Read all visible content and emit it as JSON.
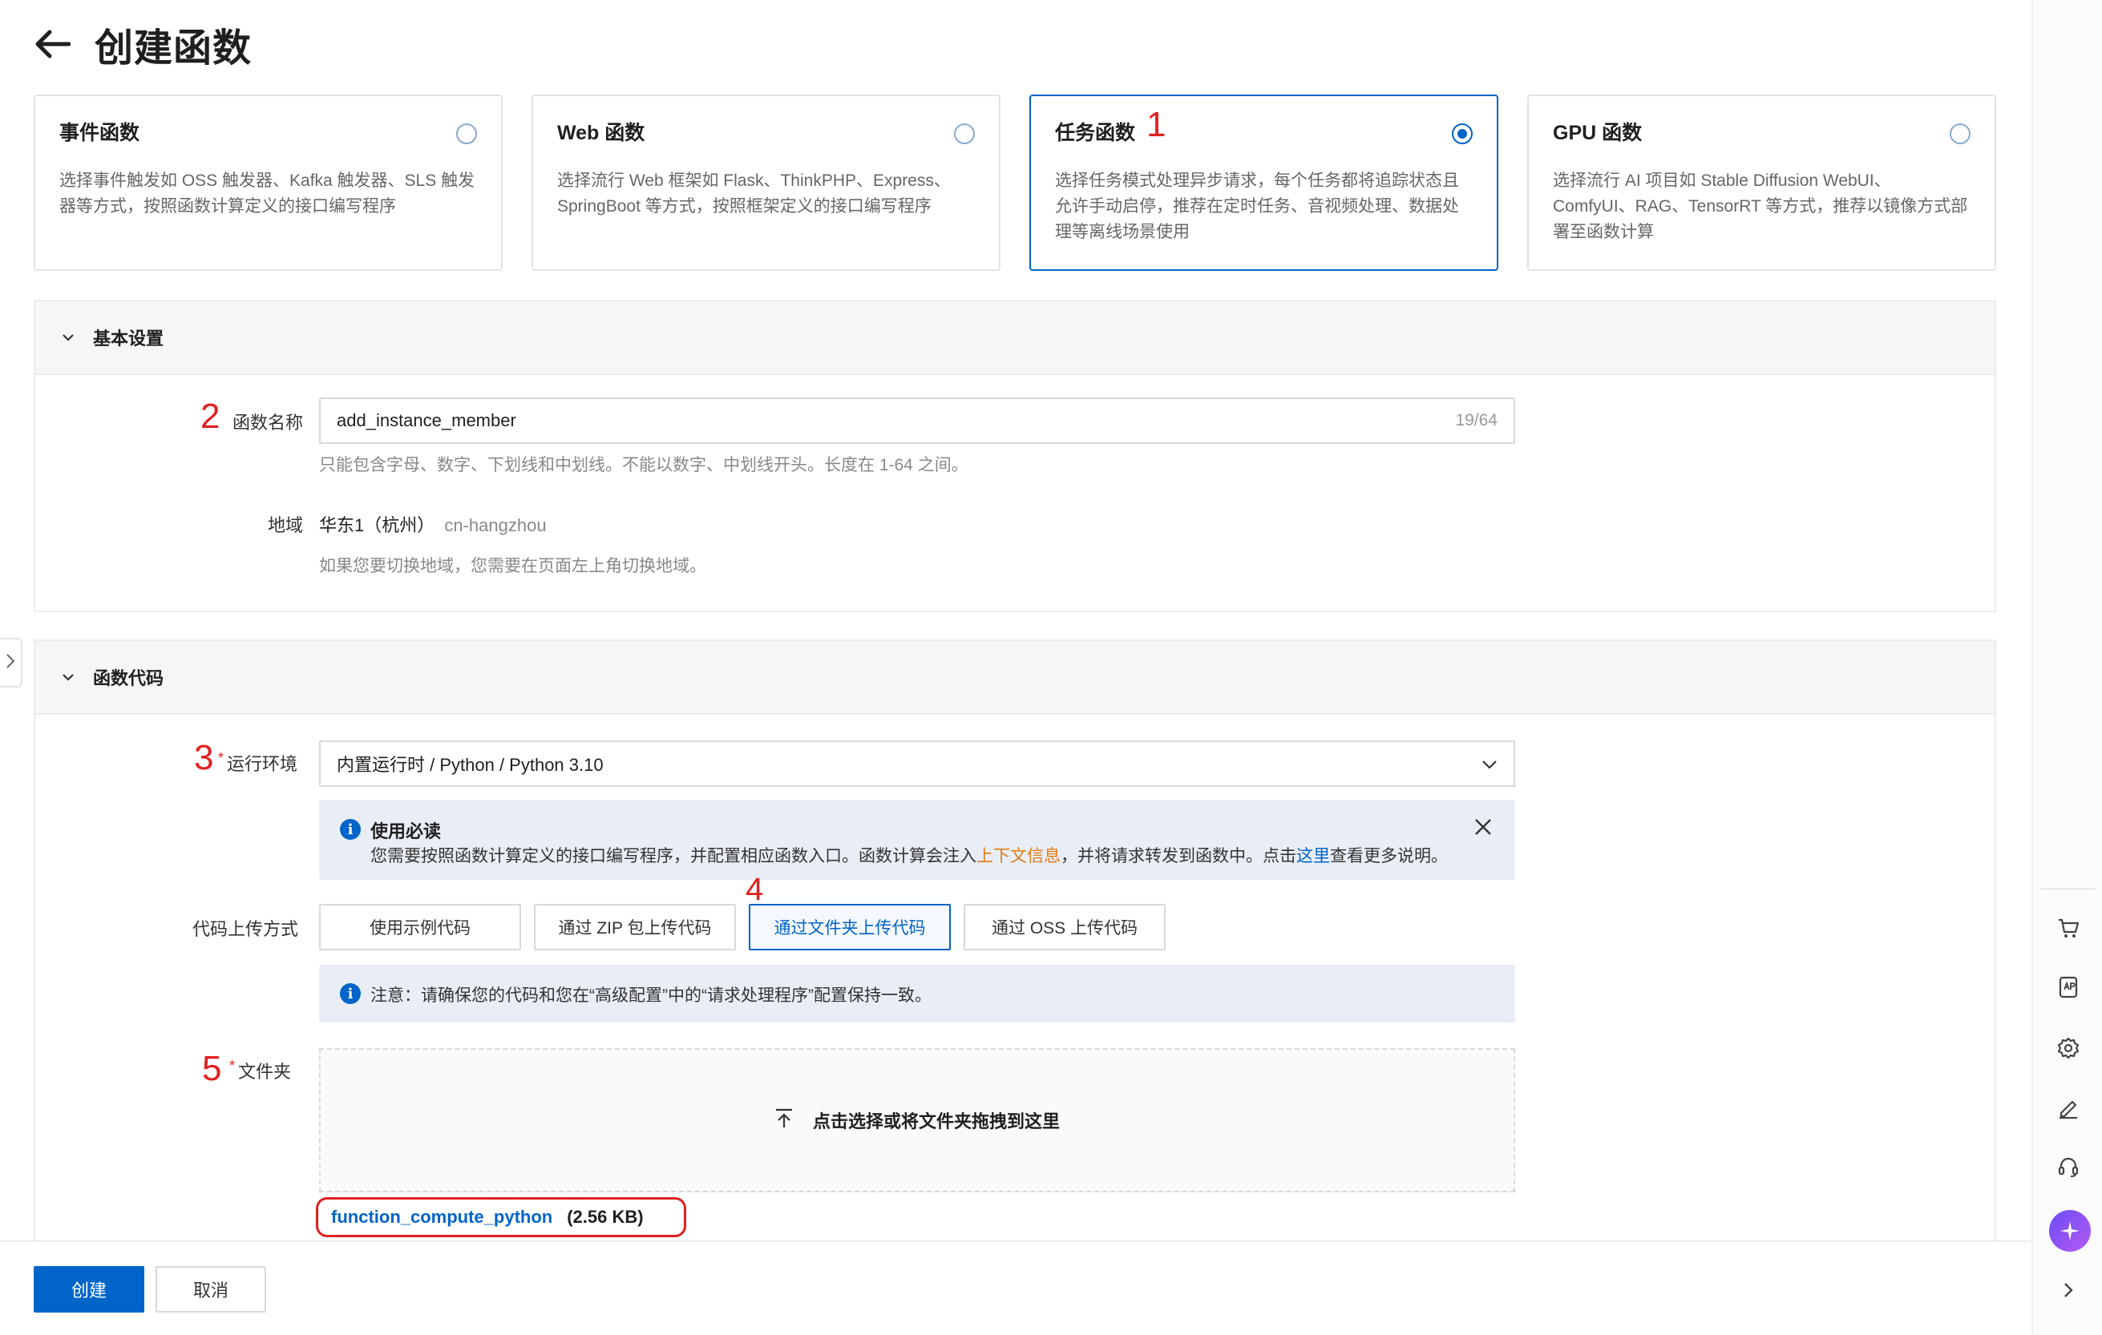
{
  "page": {
    "title": "创建函数"
  },
  "cards": [
    {
      "title": "事件函数",
      "desc": "选择事件触发如 OSS 触发器、Kafka 触发器、SLS 触发器等方式，按照函数计算定义的接口编写程序",
      "selected": false
    },
    {
      "title": "Web 函数",
      "desc": "选择流行 Web 框架如 Flask、ThinkPHP、Express、SpringBoot 等方式，按照框架定义的接口编写程序",
      "selected": false
    },
    {
      "title": "任务函数",
      "desc": "选择任务模式处理异步请求，每个任务都将追踪状态且允许手动启停，推荐在定时任务、音视频处理、数据处理等离线场景使用",
      "selected": true
    },
    {
      "title": "GPU 函数",
      "desc": "选择流行 AI 项目如 Stable Diffusion WebUI、ComfyUI、RAG、TensorRT 等方式，推荐以镜像方式部署至函数计算",
      "selected": false
    }
  ],
  "markers": {
    "m1": "1",
    "m2": "2",
    "m3": "3",
    "m4": "4",
    "m5": "5"
  },
  "basic": {
    "title": "基本设置",
    "name_label": "函数名称",
    "name_value": "add_instance_member",
    "name_count": "19/64",
    "name_hint": "只能包含字母、数字、下划线和中划线。不能以数字、中划线开头。长度在 1-64 之间。",
    "region_label": "地域",
    "region_value": "华东1（杭州）",
    "region_id": "cn-hangzhou",
    "region_hint": "如果您要切换地域，您需要在页面左上角切换地域。"
  },
  "code": {
    "title": "函数代码",
    "runtime_label": "运行环境",
    "runtime_value": "内置运行时 / Python / Python 3.10",
    "notice_title": "使用必读",
    "notice_text_1": "您需要按照函数计算定义的接口编写程序，并配置相应函数入口。函数计算会注入",
    "notice_link_1": "上下文信息",
    "notice_text_2": "，并将请求转发到函数中。点击",
    "notice_link_2": "这里",
    "notice_text_3": "查看更多说明。",
    "upload_label": "代码上传方式",
    "upload_tabs": [
      "使用示例代码",
      "通过 ZIP 包上传代码",
      "通过文件夹上传代码",
      "通过 OSS 上传代码"
    ],
    "upload_active_index": 2,
    "note_text": "注意：请确保您的代码和您在“高级配置”中的“请求处理程序”配置保持一致。",
    "folder_label": "文件夹",
    "dropzone_text": "点击选择或将文件夹拖拽到这里",
    "file_name": "function_compute_python",
    "file_size": "(2.56 KB)"
  },
  "footer": {
    "create": "创建",
    "cancel": "取消"
  },
  "colors": {
    "primary": "#0064c8",
    "marker": "#e02020",
    "link_orange": "#e27a12"
  }
}
